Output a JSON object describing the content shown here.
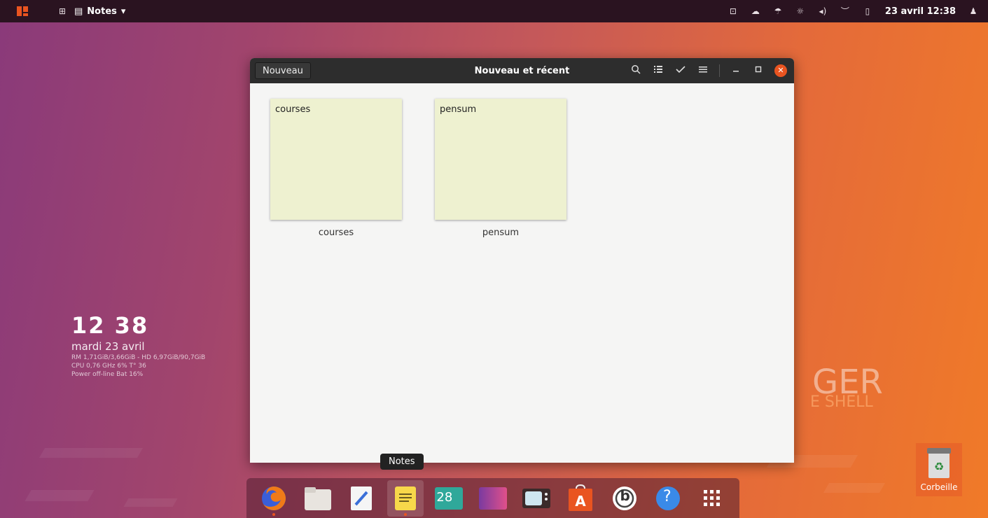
{
  "topbar": {
    "app_name": "Notes",
    "app_arrow": "▾",
    "clock": "23 avril 12:38",
    "indicators": [
      "terminal-icon",
      "cloud-icon",
      "weather-icon",
      "brightness-icon",
      "volume-icon",
      "wifi-icon",
      "battery-icon",
      "user-icon"
    ]
  },
  "window": {
    "new_button": "Nouveau",
    "title": "Nouveau et récent",
    "notes": [
      {
        "content": "courses",
        "label": "courses"
      },
      {
        "content": "pensum",
        "label": "pensum"
      }
    ]
  },
  "widget": {
    "time": "12 38",
    "date": "mardi 23 avril",
    "ram": "RM 1,71GiB/3,66GiB - HD 6,97GiB/90,7GiB",
    "cpu": "CPU 0,76 GHz 6% T° 36",
    "power": "Power off-line Bat 16%"
  },
  "wallpaper": {
    "big": "GER",
    "sub": "E SHELL"
  },
  "tooltip": "Notes",
  "dock": {
    "calendar_day": "28",
    "help_glyph": "?",
    "budgie_glyph": "b"
  },
  "trash": {
    "label": "Corbeille"
  },
  "colors": {
    "accent": "#e95420",
    "note_bg": "#eef1d0",
    "headerbar": "#2d2d2d"
  }
}
